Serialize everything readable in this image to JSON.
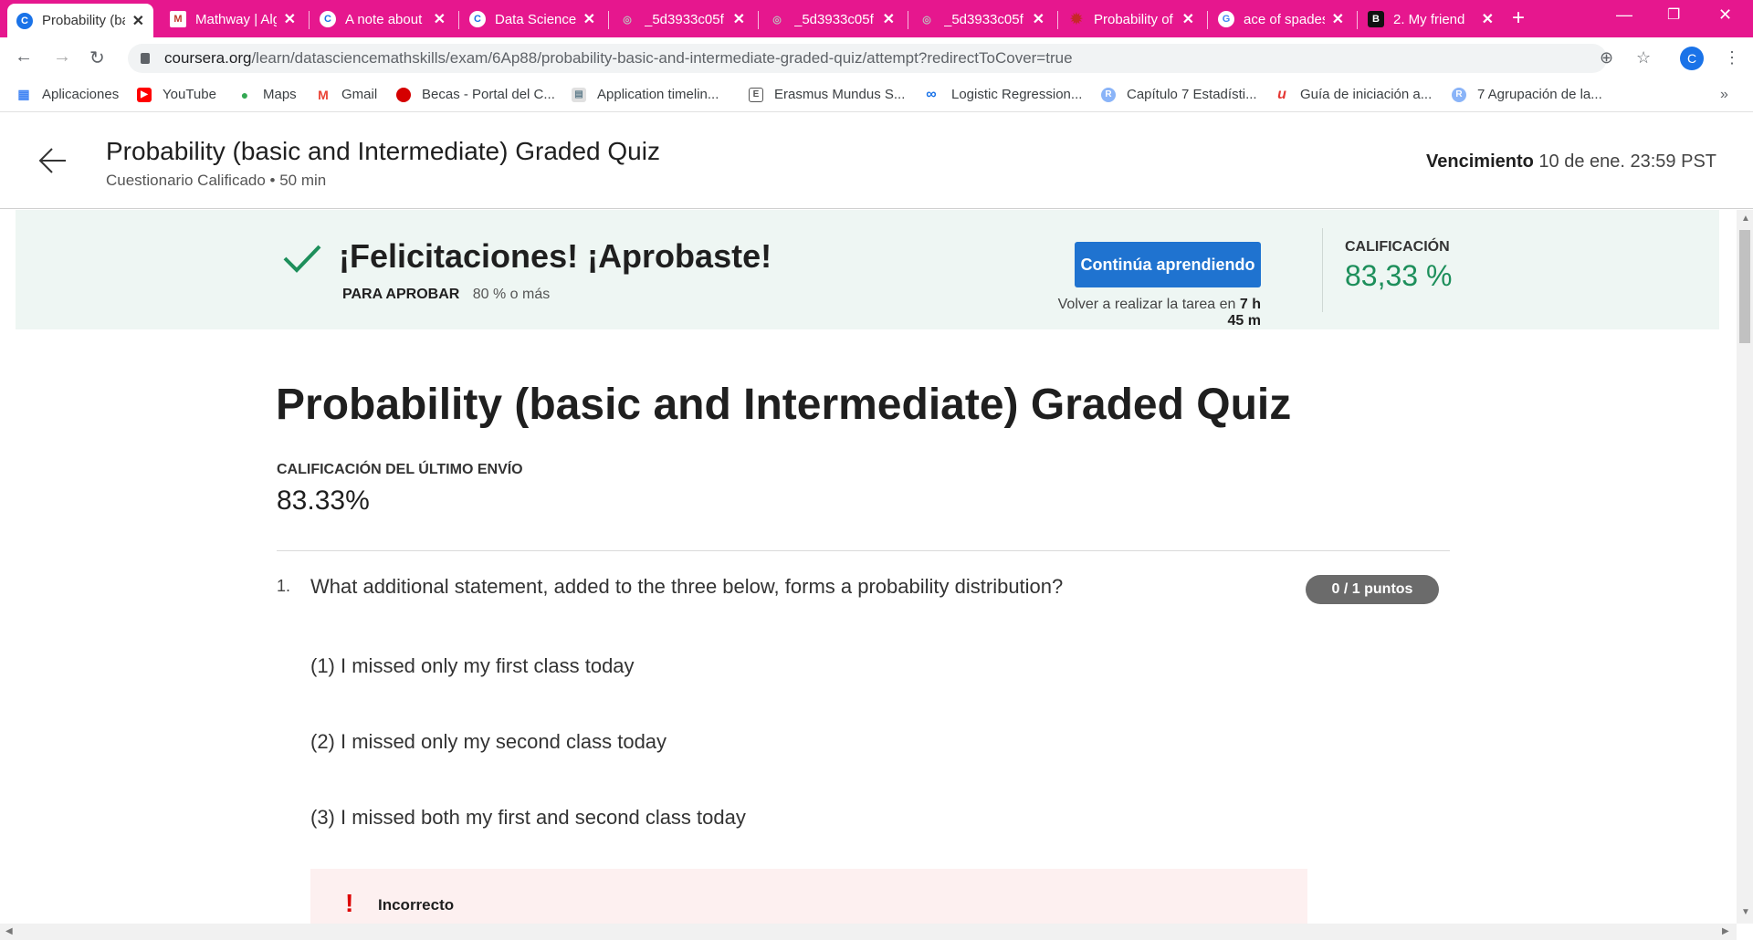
{
  "browser": {
    "tabs": [
      {
        "title": "Probability (basic and Int",
        "icon_text": "C",
        "icon_color": "#1a73e8",
        "active": true
      },
      {
        "title": "Mathway | Algebra",
        "icon_text": "M",
        "icon_color": "#c0392b",
        "active": false
      },
      {
        "title": "A note about",
        "icon_text": "C",
        "icon_color": "#1a73e8",
        "active": false
      },
      {
        "title": "Data Science",
        "icon_text": "C",
        "icon_color": "#1a73e8",
        "active": false
      },
      {
        "title": "_5d3933c05f",
        "icon_text": "◎",
        "icon_color": "#9e9e9e",
        "active": false
      },
      {
        "title": "_5d3933c05f",
        "icon_text": "◎",
        "icon_color": "#9e9e9e",
        "active": false
      },
      {
        "title": "_5d3933c05f",
        "icon_text": "◎",
        "icon_color": "#9e9e9e",
        "active": false
      },
      {
        "title": "Probability of",
        "icon_text": "✹",
        "icon_color": "#c62828",
        "active": false
      },
      {
        "title": "ace of spades",
        "icon_text": "G",
        "icon_color": "#ffffff",
        "active": false
      },
      {
        "title": "2. My friend",
        "icon_text": "B",
        "icon_color": "#111111",
        "active": false
      }
    ],
    "url_host": "coursera.org",
    "url_path": "/learn/datasciencemathskills/exam/6Ap88/probability-basic-and-intermediate-graded-quiz/attempt?redirectToCover=true",
    "profile_initial": "C",
    "bookmarks": [
      {
        "label": "Aplicaciones",
        "icon": "apps-grid-icon",
        "color": "#4285f4"
      },
      {
        "label": "YouTube",
        "icon": "youtube-icon",
        "color": "#ff0000"
      },
      {
        "label": "Maps",
        "icon": "maps-pin-icon",
        "color": "#34a853"
      },
      {
        "label": "Gmail",
        "icon": "gmail-icon",
        "color": "#ea4335"
      },
      {
        "label": "Becas - Portal del C...",
        "icon": "circle-icon",
        "color": "#d50000"
      },
      {
        "label": "Application timelin...",
        "icon": "document-icon",
        "color": "#607d8b"
      },
      {
        "label": "Erasmus Mundus S...",
        "icon": "shield-icon",
        "color": "#555555"
      },
      {
        "label": "Logistic Regression...",
        "icon": "infinity-icon",
        "color": "#1a73e8"
      },
      {
        "label": "Capítulo 7 Estadísti...",
        "icon": "r-icon",
        "color": "#8ab4f8"
      },
      {
        "label": "Guía de iniciación a...",
        "icon": "u-icon",
        "color": "#e53935"
      },
      {
        "label": "7 Agrupación de la...",
        "icon": "r-icon",
        "color": "#8ab4f8"
      }
    ]
  },
  "header": {
    "title": "Probability (basic and Intermediate) Graded Quiz",
    "subtitle": "Cuestionario Calificado • 50 min",
    "due_label": "Vencimiento",
    "due_value": "10 de ene. 23:59 PST"
  },
  "banner": {
    "message": "¡Felicitaciones! ¡Aprobaste!",
    "to_pass_label": "PARA APROBAR",
    "to_pass_value": "80 % o más",
    "continue_label": "Continúa aprendiendo",
    "retake_prefix": "Volver a realizar la tarea en",
    "retake_time": "7 h 45 m",
    "grade_label": "CALIFICACIÓN",
    "grade_value": "83,33 %",
    "accent": "#1d8f5b",
    "button_color": "#1f73d0"
  },
  "quiz": {
    "title": "Probability (basic and Intermediate) Graded Quiz",
    "last_submission_label": "CALIFICACIÓN DEL ÚLTIMO ENVÍO",
    "last_submission_value": "83.33%",
    "question": {
      "number": "1.",
      "text": "What additional statement, added to the three below, forms a probability distribution?",
      "points": "0 / 1 puntos",
      "options": [
        "(1) I missed only my first class today",
        "(2) I missed only my second class today",
        "(3) I missed both my first and second class today"
      ],
      "feedback_icon": "!",
      "feedback_label": "Incorrecto"
    }
  }
}
